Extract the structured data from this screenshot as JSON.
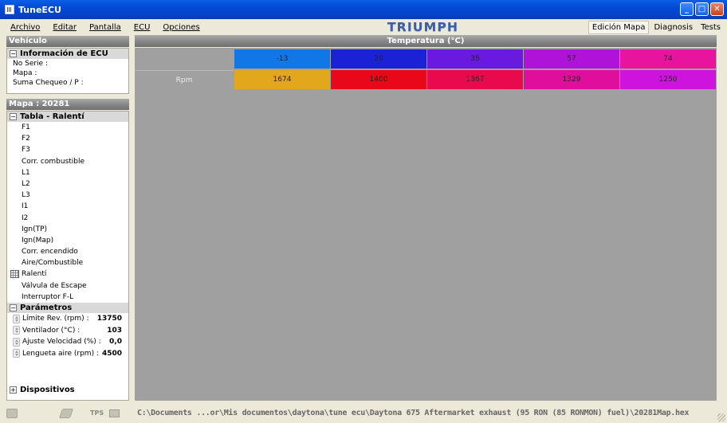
{
  "window": {
    "title": "TuneECU"
  },
  "menu": [
    "Archivo",
    "Editar",
    "Pantalla",
    "ECU",
    "Opciones"
  ],
  "logo": "TRIUMPH",
  "tabs": [
    "Edición Mapa",
    "Diagnosis",
    "Tests"
  ],
  "vehicle": {
    "header": "Vehículo",
    "group": "Información de ECU",
    "fields": [
      "No Serie :",
      "Mapa :",
      "Suma Chequeo / P :"
    ]
  },
  "map": {
    "header": "Mapa : 20281",
    "group": "Tabla - Ralentí",
    "items": [
      "F1",
      "F2",
      "F3",
      "Corr. combustible",
      "L1",
      "L2",
      "L3",
      "I1",
      "I2",
      "Ign(TP)",
      "Ign(Map)",
      "Corr. encendido",
      "Aire/Combustible",
      "Ralentí",
      "Válvula de Escape",
      "Interruptor F-L"
    ],
    "selected_index": 13,
    "params_header": "Parámetros",
    "params": [
      {
        "label": "Límite Rev. (rpm) :",
        "value": "13750"
      },
      {
        "label": "Ventilador (°C) :",
        "value": "103"
      },
      {
        "label": "Ajuste Velocidad (%) :",
        "value": "0,0"
      },
      {
        "label": "Lengueta aire (rpm) :",
        "value": "4500"
      }
    ],
    "devices_header": "Dispositivos"
  },
  "table": {
    "header": "Temperatura (°C)",
    "row_label": "Rpm",
    "temperatures": [
      "-13",
      "20",
      "35",
      "57",
      "74"
    ],
    "rpm": [
      "1674",
      "1400",
      "1367",
      "1329",
      "1250"
    ],
    "temp_colors": [
      "#1177e6",
      "#1b22d6",
      "#6a19de",
      "#b013d8",
      "#e814a0"
    ],
    "rpm_colors": [
      "#e3a71e",
      "#e8081a",
      "#e80a4d",
      "#e00e9c",
      "#cc14dd"
    ],
    "label_color": "#a0a0a0"
  },
  "status": {
    "tps_label": "TPS",
    "path": "C:\\Documents ...or\\Mis documentos\\daytona\\tune ecu\\Daytona 675  Aftermarket exhaust (95 RON (85 RONMON) fuel)\\20281Map.hex"
  }
}
